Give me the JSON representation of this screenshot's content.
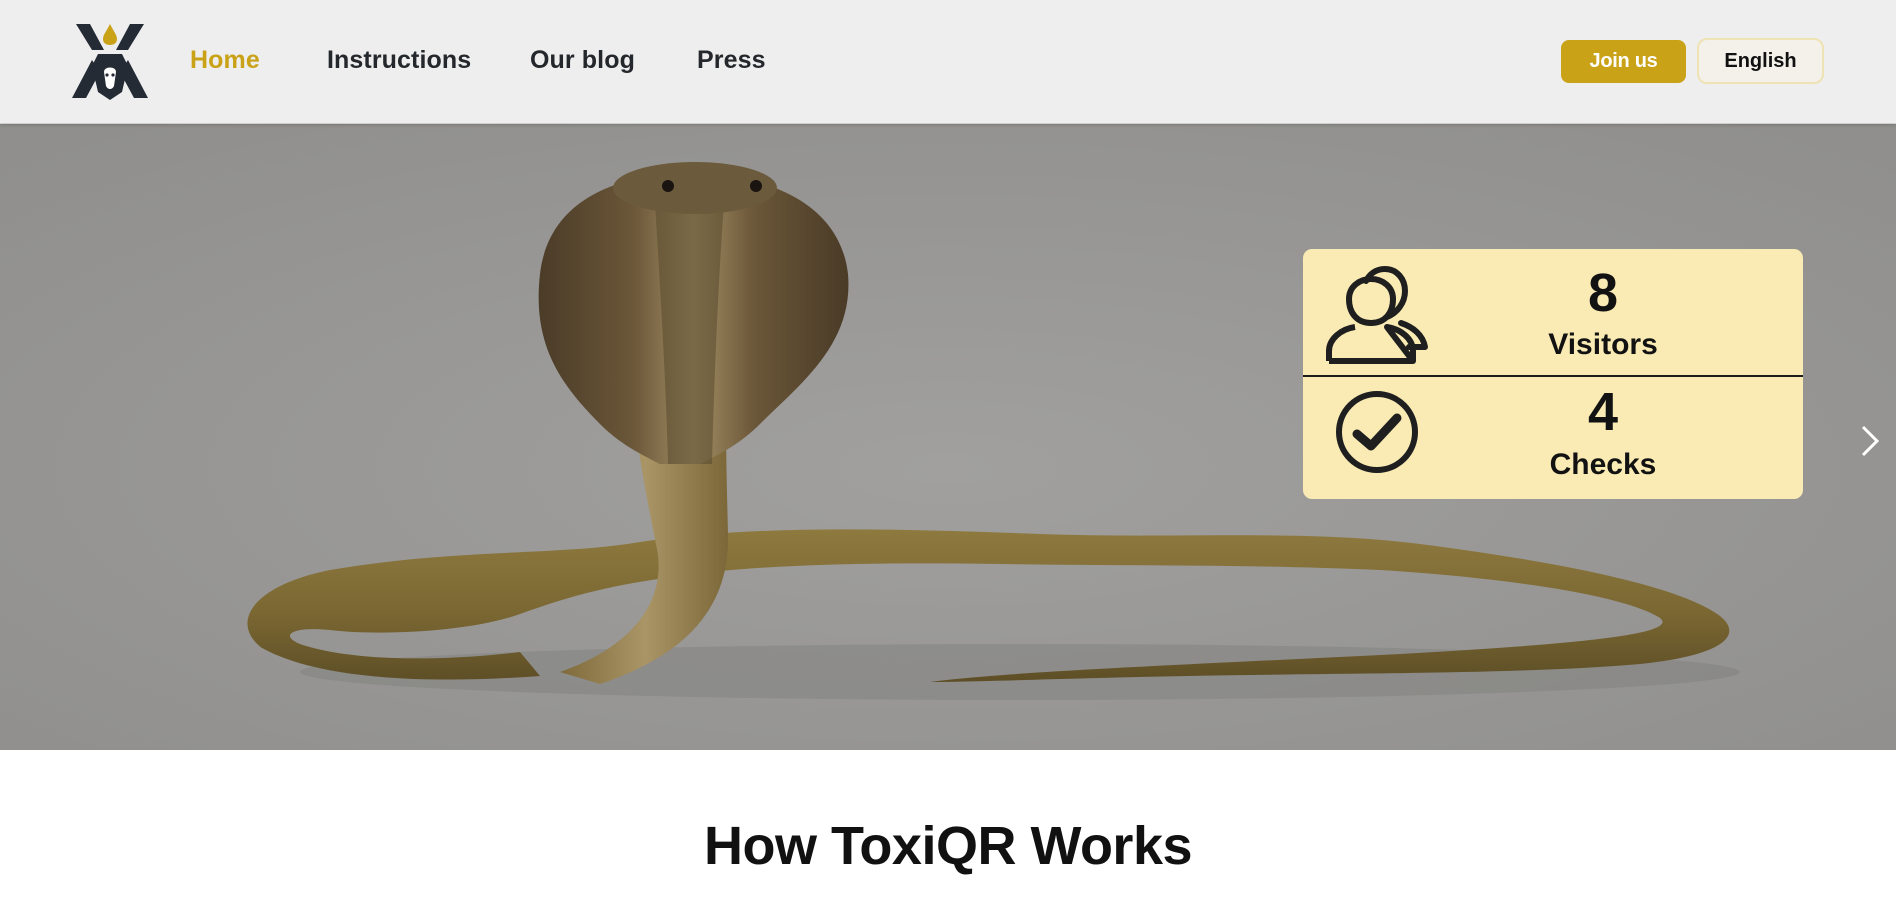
{
  "header": {
    "nav": [
      {
        "label": "Home",
        "active": true
      },
      {
        "label": "Instructions",
        "active": false
      },
      {
        "label": "Our blog",
        "active": false
      },
      {
        "label": "Press",
        "active": false
      }
    ],
    "join_label": "Join us",
    "language_label": "English"
  },
  "stats": {
    "visitors": {
      "value": "8",
      "label": "Visitors",
      "icon": "users-icon"
    },
    "checks": {
      "value": "4",
      "label": "Checks",
      "icon": "check-circle-icon"
    }
  },
  "section": {
    "title": "How ToxiQR Works"
  },
  "colors": {
    "accent": "#c9a218",
    "header_bg": "#eeeeee",
    "card_bg": "#f9ebb3",
    "hero_bg": "#959493"
  }
}
